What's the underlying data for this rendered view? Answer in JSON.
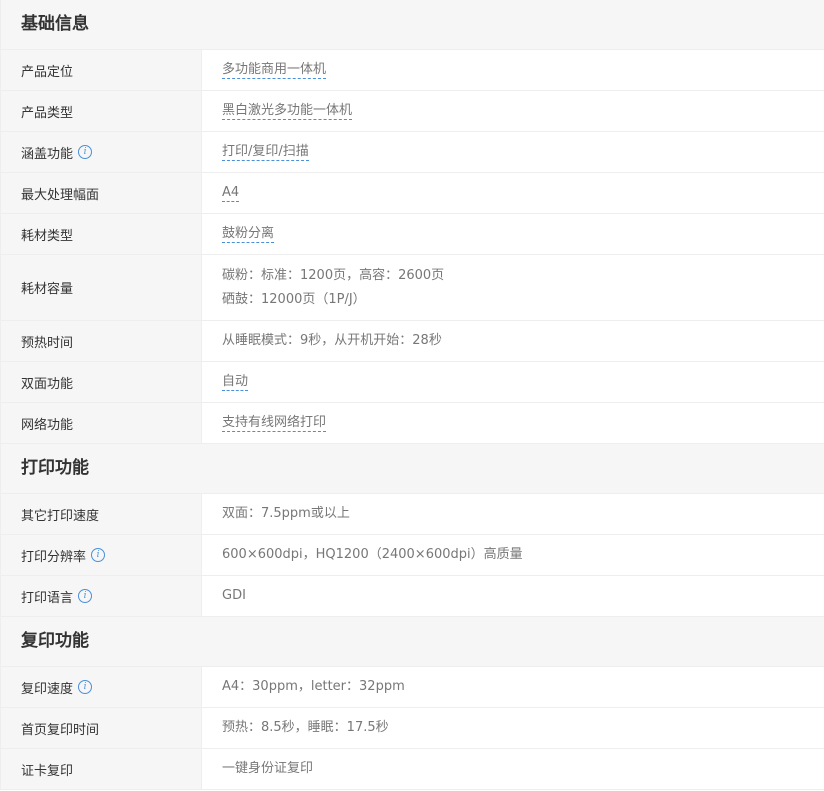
{
  "sections": [
    {
      "title": "基础信息",
      "rows": [
        {
          "label": "产品定位",
          "value": "多功能商用一体机",
          "linked": true
        },
        {
          "label": "产品类型",
          "value": "黑白激光多功能一体机",
          "linked": true
        },
        {
          "label": "涵盖功能",
          "value": "打印/复印/扫描",
          "linked": true,
          "info": true
        },
        {
          "label": "最大处理幅面",
          "value": "A4",
          "linked": true
        },
        {
          "label": "耗材类型",
          "value": "鼓粉分离",
          "linked": true
        },
        {
          "label": "耗材容量",
          "lines": [
            "碳粉：标准：1200页，高容：2600页",
            "硒鼓：12000页（1P/J）"
          ]
        },
        {
          "label": "预热时间",
          "value": "从睡眠模式：9秒，从开机开始：28秒"
        },
        {
          "label": "双面功能",
          "value": "自动",
          "linked": true
        },
        {
          "label": "网络功能",
          "value": "支持有线网络打印",
          "linked": true
        }
      ]
    },
    {
      "title": "打印功能",
      "rows": [
        {
          "label": "其它打印速度",
          "value": "双面：7.5ppm或以上"
        },
        {
          "label": "打印分辨率",
          "value": "600×600dpi，HQ1200（2400×600dpi）高质量",
          "info": true
        },
        {
          "label": "打印语言",
          "value": "GDI",
          "info": true
        }
      ]
    },
    {
      "title": "复印功能",
      "rows": [
        {
          "label": "复印速度",
          "value": "A4：30ppm，letter：32ppm",
          "info": true
        },
        {
          "label": "首页复印时间",
          "value": "预热：8.5秒，睡眠：17.5秒"
        },
        {
          "label": "证卡复印",
          "value": "一键身份证复印"
        }
      ]
    }
  ],
  "icons": {
    "info": "info-icon",
    "info_glyph": "i"
  },
  "colors": {
    "accent": "#4a90d9",
    "label_bg": "#f6f6f6",
    "border": "#eeeeee",
    "value_text": "#777777"
  }
}
